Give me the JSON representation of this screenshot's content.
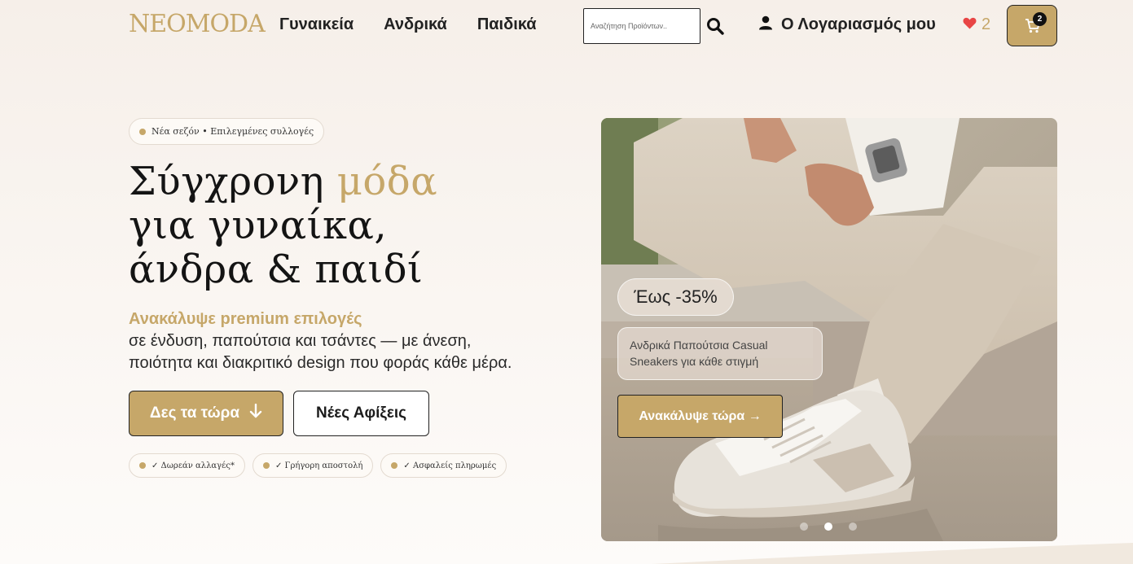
{
  "header": {
    "logo": "NEOMODA",
    "nav": [
      "Γυναικεία",
      "Ανδρικά",
      "Παιδικά"
    ],
    "search_placeholder": "Αναζήτηση Προϊόντων..",
    "account_label": "Ο Λογαριασμός μου",
    "wishlist_count": "2",
    "cart_count": "2"
  },
  "hero": {
    "tag": "Νέα σεζόν • Επιλεγμένες συλλογές",
    "title_part1": "Σύγχρονη ",
    "title_accent": "μόδα",
    "title_line2": "για γυναίκα,",
    "title_line3": "άνδρα & παιδί",
    "subtitle_highlight": "Ανακάλυψε premium επιλογές",
    "subtitle_line1": "σε ένδυση, παπούτσια και τσάντες — με άνεση,",
    "subtitle_line2": "ποιότητα και διακριτικό design που φοράς κάθε μέρα.",
    "primary_button": "Δες τα τώρα",
    "secondary_button": "Νέες Αφίξεις",
    "features": [
      "✓ Δωρεάν αλλαγές*",
      "✓ Γρήγορη αποστολή",
      "✓ Ασφαλείς πληρωμές"
    ]
  },
  "promo": {
    "badge": "Έως -35%",
    "text": "Ανδρικά Παπούτσια Casual Sneakers για κάθε στιγμή",
    "cta": "Ανακάλυψε τώρα →",
    "slides_total": 3,
    "active_slide": 2
  },
  "colors": {
    "accent": "#c6a769",
    "text": "#1b1b1b",
    "background": "#f6efe9",
    "heart": "#e84545"
  },
  "icons": [
    "search-icon",
    "user-icon",
    "heart-icon",
    "cart-icon",
    "arrow-down-icon"
  ]
}
